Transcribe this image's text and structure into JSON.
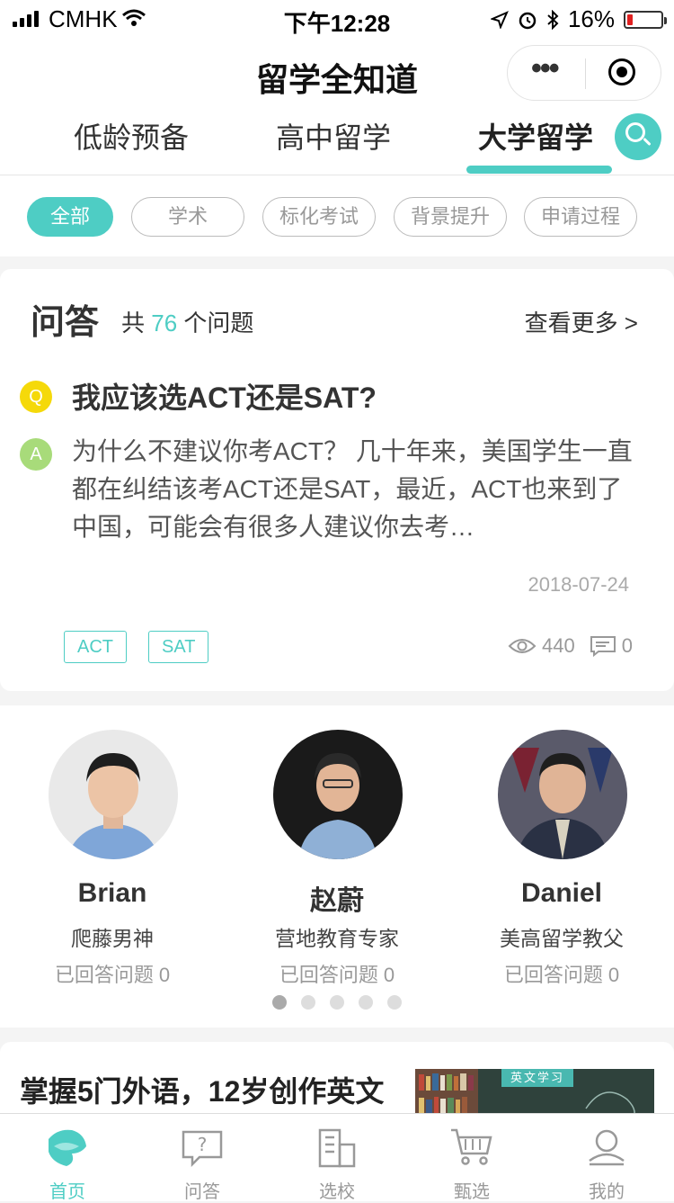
{
  "status_bar": {
    "carrier": "CMHK",
    "time": "下午12:28",
    "battery": "16%",
    "battery_level": 0.16
  },
  "header": {
    "title": "留学全知道"
  },
  "category_tabs": [
    {
      "label": "低龄预备",
      "active": false
    },
    {
      "label": "高中留学",
      "active": false
    },
    {
      "label": "大学留学",
      "active": true
    }
  ],
  "filters": [
    {
      "label": "全部",
      "active": true
    },
    {
      "label": "学术",
      "active": false
    },
    {
      "label": "标化考试",
      "active": false
    },
    {
      "label": "背景提升",
      "active": false
    },
    {
      "label": "申请过程",
      "active": false
    }
  ],
  "qa": {
    "title": "问答",
    "count_prefix": "共",
    "count": "76",
    "count_suffix": "个问题",
    "more_label": "查看更多 >",
    "q_badge": "Q",
    "a_badge": "A",
    "question": "我应该选ACT还是SAT?",
    "answer": "为什么不建议你考ACT？ 几十年来，美国学生一直都在纠结该考ACT还是SAT，最近，ACT也来到了中国，可能会有很多人建议你去考…",
    "date": "2018-07-24",
    "tags": [
      "ACT",
      "SAT"
    ],
    "views": "440",
    "comments": "0"
  },
  "experts": [
    {
      "name": "Brian",
      "title": "爬藤男神",
      "answered": "已回答问题 0"
    },
    {
      "name": "赵蔚",
      "title": "营地教育专家",
      "answered": "已回答问题 0"
    },
    {
      "name": "Daniel",
      "title": "美高留学教父",
      "answered": "已回答问题 0"
    }
  ],
  "carousel": {
    "count": 5,
    "active_index": 0
  },
  "article": {
    "title": "掌握5门外语，12岁创作英文",
    "image_caption": "英文学习"
  },
  "tabbar": [
    {
      "label": "首页",
      "icon": "home-icon",
      "active": true
    },
    {
      "label": "问答",
      "icon": "question-bubble-icon",
      "active": false
    },
    {
      "label": "选校",
      "icon": "school-building-icon",
      "active": false
    },
    {
      "label": "甄选",
      "icon": "cart-icon",
      "active": false
    },
    {
      "label": "我的",
      "icon": "profile-icon",
      "active": false
    }
  ]
}
